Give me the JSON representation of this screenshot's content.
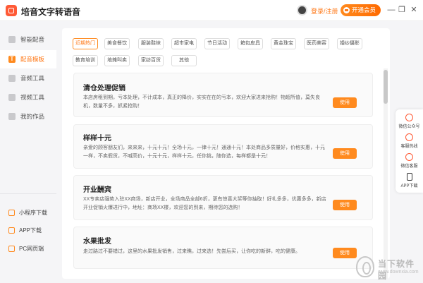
{
  "app": {
    "title": "培音文字转语音"
  },
  "header": {
    "login_label": "登录/注册",
    "vip_label": "开通会员",
    "window_controls": {
      "minimize": "—",
      "maximize": "❐",
      "close": "✕"
    }
  },
  "sidebar": {
    "items": [
      {
        "label": "智能配音",
        "icon": "smart-dub-icon"
      },
      {
        "label": "配音模板",
        "icon": "template-icon",
        "icon_text": "T"
      },
      {
        "label": "音频工具",
        "icon": "audio-tool-icon"
      },
      {
        "label": "视频工具",
        "icon": "video-tool-icon"
      },
      {
        "label": "我的作品",
        "icon": "folder-icon"
      }
    ],
    "bottom_items": [
      {
        "label": "小程序下载",
        "icon": "mini-program-icon"
      },
      {
        "label": "APP下载",
        "icon": "phone-icon"
      },
      {
        "label": "PC网页端",
        "icon": "pc-icon"
      }
    ]
  },
  "categories": [
    "近期热门",
    "美食餐饮",
    "服装鞋袜",
    "超市家电",
    "节日活动",
    "箱包皮具",
    "黄金珠宝",
    "医药美容",
    "婚纱摄影",
    "教育培训",
    "地摊叫卖",
    "家纺百货",
    "其他"
  ],
  "active_category": "近期热门",
  "templates": [
    {
      "title": "清仓处理促销",
      "body": "本店房租到期，亏本处理，不计成本，真正的降价，实实在在的亏本，欢迎大家进来抢购！物超所值，莫失良机，数量不多，抓紧抢购！",
      "button": "使用"
    },
    {
      "title": "样样十元",
      "body": "亲爱的顾客朋友们，来来来，十元十元！全场十元，一律十元！通通十元！本处商品多质量好，价格实惠，十元一样，不卖假货，不喊高价，十元十元，样样十元，任你挑，随你选，每样都是十元！",
      "button": "使用"
    },
    {
      "title": "开业酬宾",
      "body": "XX专卖店强势入驻XX商场，新店开业，全场商品全部6折，更有惊喜大奖等你抽取！好礼多多，优惠多多，新店开业促销火爆进行中，地址：商场XX楼，欢迎您的到来，期待您的选购！",
      "button": "使用"
    },
    {
      "title": "水果批发",
      "body": "走过路过不要错过，这里的水果批发销售，过来瞧，过来选！先尝后买，让你吃的新鲜，吃的健康。",
      "button": "使用"
    }
  ],
  "right_panel": [
    {
      "label": "微信公众号",
      "icon": "wechat-official-icon"
    },
    {
      "label": "客服热线",
      "icon": "phone-hotline-icon"
    },
    {
      "label": "微信客服",
      "icon": "wechat-service-icon"
    },
    {
      "label": "APP下载",
      "icon": "app-download-icon"
    }
  ],
  "watermark": {
    "text": "当下软件园",
    "url": "www.downxia.com"
  },
  "colors": {
    "accent": "#ff7a1a",
    "brand_red": "#ff5a36"
  }
}
